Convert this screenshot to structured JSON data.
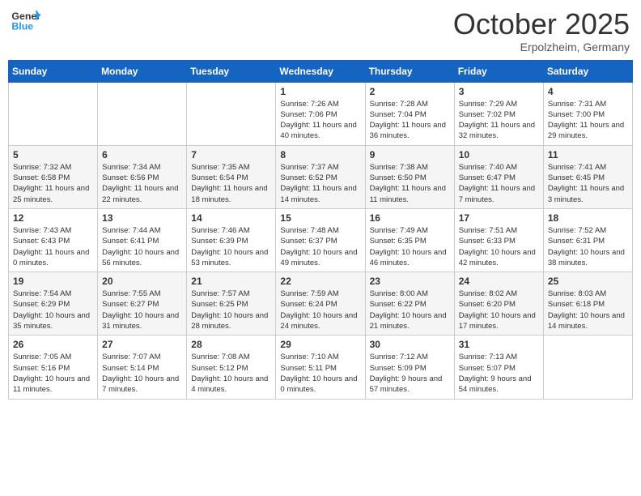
{
  "header": {
    "logo_line1": "General",
    "logo_line2": "Blue",
    "month": "October 2025",
    "location": "Erpolzheim, Germany"
  },
  "days_of_week": [
    "Sunday",
    "Monday",
    "Tuesday",
    "Wednesday",
    "Thursday",
    "Friday",
    "Saturday"
  ],
  "weeks": [
    [
      {
        "day": "",
        "info": ""
      },
      {
        "day": "",
        "info": ""
      },
      {
        "day": "",
        "info": ""
      },
      {
        "day": "1",
        "info": "Sunrise: 7:26 AM\nSunset: 7:06 PM\nDaylight: 11 hours and 40 minutes."
      },
      {
        "day": "2",
        "info": "Sunrise: 7:28 AM\nSunset: 7:04 PM\nDaylight: 11 hours and 36 minutes."
      },
      {
        "day": "3",
        "info": "Sunrise: 7:29 AM\nSunset: 7:02 PM\nDaylight: 11 hours and 32 minutes."
      },
      {
        "day": "4",
        "info": "Sunrise: 7:31 AM\nSunset: 7:00 PM\nDaylight: 11 hours and 29 minutes."
      }
    ],
    [
      {
        "day": "5",
        "info": "Sunrise: 7:32 AM\nSunset: 6:58 PM\nDaylight: 11 hours and 25 minutes."
      },
      {
        "day": "6",
        "info": "Sunrise: 7:34 AM\nSunset: 6:56 PM\nDaylight: 11 hours and 22 minutes."
      },
      {
        "day": "7",
        "info": "Sunrise: 7:35 AM\nSunset: 6:54 PM\nDaylight: 11 hours and 18 minutes."
      },
      {
        "day": "8",
        "info": "Sunrise: 7:37 AM\nSunset: 6:52 PM\nDaylight: 11 hours and 14 minutes."
      },
      {
        "day": "9",
        "info": "Sunrise: 7:38 AM\nSunset: 6:50 PM\nDaylight: 11 hours and 11 minutes."
      },
      {
        "day": "10",
        "info": "Sunrise: 7:40 AM\nSunset: 6:47 PM\nDaylight: 11 hours and 7 minutes."
      },
      {
        "day": "11",
        "info": "Sunrise: 7:41 AM\nSunset: 6:45 PM\nDaylight: 11 hours and 3 minutes."
      }
    ],
    [
      {
        "day": "12",
        "info": "Sunrise: 7:43 AM\nSunset: 6:43 PM\nDaylight: 11 hours and 0 minutes."
      },
      {
        "day": "13",
        "info": "Sunrise: 7:44 AM\nSunset: 6:41 PM\nDaylight: 10 hours and 56 minutes."
      },
      {
        "day": "14",
        "info": "Sunrise: 7:46 AM\nSunset: 6:39 PM\nDaylight: 10 hours and 53 minutes."
      },
      {
        "day": "15",
        "info": "Sunrise: 7:48 AM\nSunset: 6:37 PM\nDaylight: 10 hours and 49 minutes."
      },
      {
        "day": "16",
        "info": "Sunrise: 7:49 AM\nSunset: 6:35 PM\nDaylight: 10 hours and 46 minutes."
      },
      {
        "day": "17",
        "info": "Sunrise: 7:51 AM\nSunset: 6:33 PM\nDaylight: 10 hours and 42 minutes."
      },
      {
        "day": "18",
        "info": "Sunrise: 7:52 AM\nSunset: 6:31 PM\nDaylight: 10 hours and 38 minutes."
      }
    ],
    [
      {
        "day": "19",
        "info": "Sunrise: 7:54 AM\nSunset: 6:29 PM\nDaylight: 10 hours and 35 minutes."
      },
      {
        "day": "20",
        "info": "Sunrise: 7:55 AM\nSunset: 6:27 PM\nDaylight: 10 hours and 31 minutes."
      },
      {
        "day": "21",
        "info": "Sunrise: 7:57 AM\nSunset: 6:25 PM\nDaylight: 10 hours and 28 minutes."
      },
      {
        "day": "22",
        "info": "Sunrise: 7:59 AM\nSunset: 6:24 PM\nDaylight: 10 hours and 24 minutes."
      },
      {
        "day": "23",
        "info": "Sunrise: 8:00 AM\nSunset: 6:22 PM\nDaylight: 10 hours and 21 minutes."
      },
      {
        "day": "24",
        "info": "Sunrise: 8:02 AM\nSunset: 6:20 PM\nDaylight: 10 hours and 17 minutes."
      },
      {
        "day": "25",
        "info": "Sunrise: 8:03 AM\nSunset: 6:18 PM\nDaylight: 10 hours and 14 minutes."
      }
    ],
    [
      {
        "day": "26",
        "info": "Sunrise: 7:05 AM\nSunset: 5:16 PM\nDaylight: 10 hours and 11 minutes."
      },
      {
        "day": "27",
        "info": "Sunrise: 7:07 AM\nSunset: 5:14 PM\nDaylight: 10 hours and 7 minutes."
      },
      {
        "day": "28",
        "info": "Sunrise: 7:08 AM\nSunset: 5:12 PM\nDaylight: 10 hours and 4 minutes."
      },
      {
        "day": "29",
        "info": "Sunrise: 7:10 AM\nSunset: 5:11 PM\nDaylight: 10 hours and 0 minutes."
      },
      {
        "day": "30",
        "info": "Sunrise: 7:12 AM\nSunset: 5:09 PM\nDaylight: 9 hours and 57 minutes."
      },
      {
        "day": "31",
        "info": "Sunrise: 7:13 AM\nSunset: 5:07 PM\nDaylight: 9 hours and 54 minutes."
      },
      {
        "day": "",
        "info": ""
      }
    ]
  ]
}
